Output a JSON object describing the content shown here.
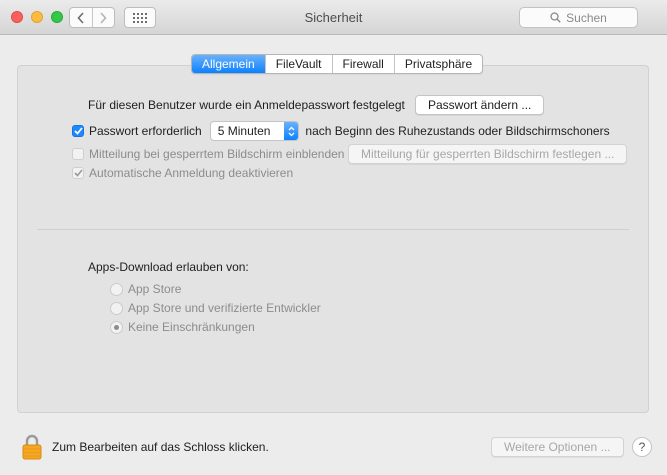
{
  "window": {
    "title": "Sicherheit",
    "search_placeholder": "Suchen"
  },
  "tabs": [
    {
      "label": "Allgemein",
      "active": true
    },
    {
      "label": "FileVault",
      "active": false
    },
    {
      "label": "Firewall",
      "active": false
    },
    {
      "label": "Privatsphäre",
      "active": false
    }
  ],
  "general": {
    "password_set_text": "Für diesen Benutzer wurde ein Anmeldepasswort festgelegt",
    "change_password_button": "Passwort ändern ...",
    "require_password_label": "Passwort erforderlich",
    "require_password_checked": true,
    "require_password_delay": "5 Minuten",
    "require_password_suffix": "nach Beginn des Ruhezustands oder Bildschirmschoners",
    "lock_message_label": "Mitteilung bei gesperrtem Bildschirm einblenden",
    "lock_message_checked": false,
    "lock_message_button": "Mitteilung für gesperrten Bildschirm festlegen ...",
    "auto_login_label": "Automatische Anmeldung deaktivieren",
    "auto_login_checked": true
  },
  "downloads": {
    "heading": "Apps-Download erlauben von:",
    "options": [
      {
        "label": "App Store",
        "selected": false
      },
      {
        "label": "App Store und verifizierte Entwickler",
        "selected": false
      },
      {
        "label": "Keine Einschränkungen",
        "selected": true
      }
    ]
  },
  "footer": {
    "lock_text": "Zum Bearbeiten auf das Schloss klicken.",
    "advanced_button": "Weitere Optionen ...",
    "help_label": "?"
  },
  "colors": {
    "accent": "#1e88fe",
    "lock": "#f5a623"
  }
}
